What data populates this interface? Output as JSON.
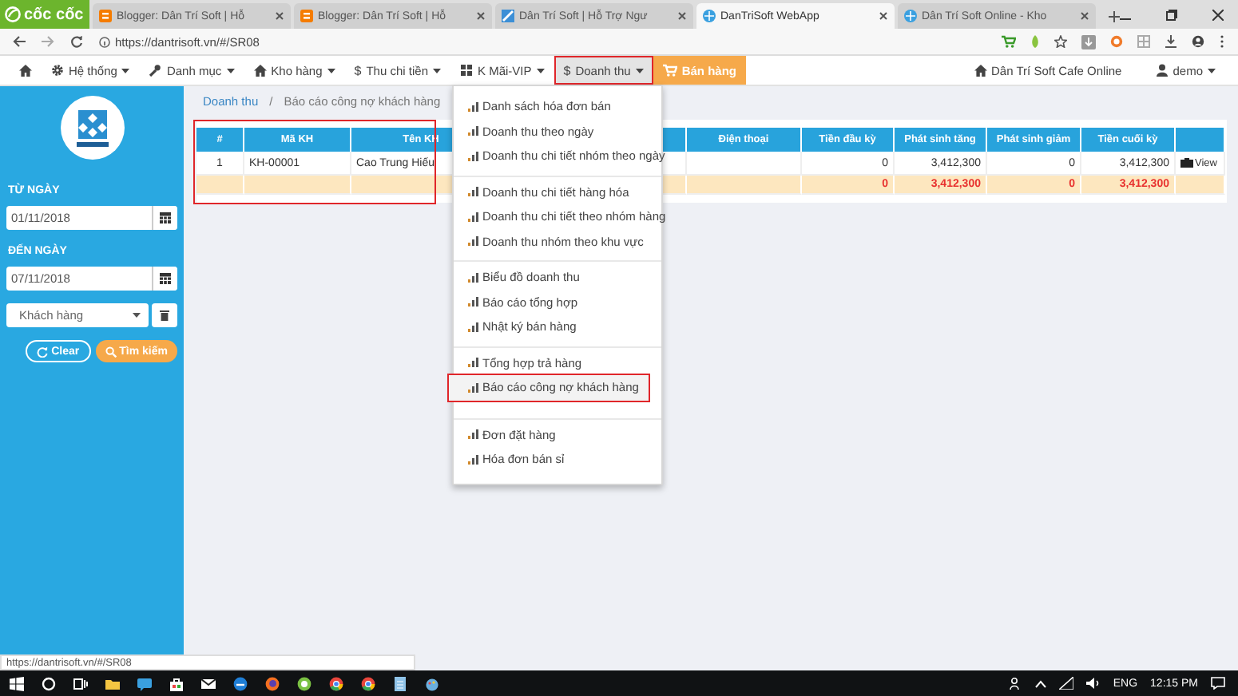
{
  "browser": {
    "brand": "cốc cốc",
    "tabs": [
      {
        "title": "Blogger: Dân Trí Soft | Hỗ",
        "kind": "blogger",
        "selected": false
      },
      {
        "title": "Blogger: Dân Trí Soft | Hỗ",
        "kind": "blogger",
        "selected": false
      },
      {
        "title": "Dân Trí Soft | Hỗ Trợ Ngư",
        "kind": "site",
        "selected": false
      },
      {
        "title": "DanTriSoft WebApp",
        "kind": "app",
        "selected": true
      },
      {
        "title": "Dân Trí Soft Online - Kho",
        "kind": "app",
        "selected": false
      }
    ],
    "url": "https://dantrisoft.vn/#/SR08",
    "status_url": "https://dantrisoft.vn/#/SR08"
  },
  "nav": {
    "items": [
      {
        "label": "Hệ thống",
        "kind": "dropdown",
        "selected": false,
        "highlighted": false
      },
      {
        "label": "Danh mục",
        "kind": "dropdown",
        "selected": false,
        "highlighted": false
      },
      {
        "label": "Kho hàng",
        "kind": "dropdown",
        "selected": false,
        "highlighted": false
      },
      {
        "label": "Thu chi tiền",
        "glyph": "$",
        "kind": "dropdown",
        "selected": false,
        "highlighted": false
      },
      {
        "label": "K Mãi-VIP",
        "kind": "dropdown",
        "selected": false,
        "highlighted": false
      },
      {
        "label": "Doanh thu",
        "glyph": "$",
        "kind": "dropdown",
        "selected": true,
        "highlighted": true
      },
      {
        "label": "Bán hàng",
        "kind": "action",
        "selected": false,
        "highlighted": false
      }
    ],
    "shop": "Dân Trí Soft Cafe Online",
    "user": "demo"
  },
  "sidebar": {
    "from_label": "TỪ NGÀY",
    "from_value": "01/11/2018",
    "to_label": "ĐẾN NGÀY",
    "to_value": "07/11/2018",
    "customer_placeholder": "Khách hàng",
    "clear_button": "Clear",
    "search_button": "Tìm kiếm"
  },
  "breadcrumb": {
    "parent": "Doanh thu",
    "separator": "/",
    "current": "Báo cáo công nợ khách hàng"
  },
  "table": {
    "highlighted": true,
    "columns": [
      "#",
      "Mã KH",
      "Tên KH",
      "Điện thoại",
      "Tiền đầu kỳ",
      "Phát sinh tăng",
      "Phát sinh giảm",
      "Tiền cuối kỳ"
    ],
    "rows": [
      {
        "kind": "data",
        "no": "1",
        "code": "KH-00001",
        "name": "Cao Trung Hiếu",
        "opening": "0",
        "increase": "3,412,300",
        "decrease": "0",
        "closing": "3,412,300",
        "action": "View"
      },
      {
        "kind": "total",
        "opening": "0",
        "increase": "3,412,300",
        "decrease": "0",
        "closing": "3,412,300"
      }
    ]
  },
  "menu": {
    "groups": [
      [
        {
          "label": "Danh sách hóa đơn bán",
          "selected": false,
          "highlighted": false
        },
        {
          "label": "Doanh thu theo ngày",
          "selected": false,
          "highlighted": false
        },
        {
          "label": "Doanh thu chi tiết nhóm theo ngày",
          "selected": false,
          "highlighted": false
        }
      ],
      [
        {
          "label": "Doanh thu chi tiết hàng hóa",
          "selected": false,
          "highlighted": false
        },
        {
          "label": "Doanh thu chi tiết theo nhóm hàng",
          "selected": false,
          "highlighted": false
        },
        {
          "label": "Doanh thu nhóm theo khu vực",
          "selected": false,
          "highlighted": false
        }
      ],
      [
        {
          "label": "Biểu đồ doanh thu",
          "selected": false,
          "highlighted": false
        },
        {
          "label": "Báo cáo tổng hợp",
          "selected": false,
          "highlighted": false
        },
        {
          "label": "Nhật ký bán hàng",
          "selected": false,
          "highlighted": false
        }
      ],
      [
        {
          "label": "Tổng hợp trả hàng",
          "selected": false,
          "highlighted": false
        },
        {
          "label": "Báo cáo công nợ khách hàng",
          "selected": true,
          "highlighted": true
        }
      ],
      [
        {
          "label": "Đơn đặt hàng",
          "selected": false,
          "highlighted": false
        },
        {
          "label": "Hóa đơn bán sỉ",
          "selected": false,
          "highlighted": false
        }
      ]
    ]
  },
  "taskbar": {
    "language": "ENG",
    "time": "12:15 PM"
  }
}
